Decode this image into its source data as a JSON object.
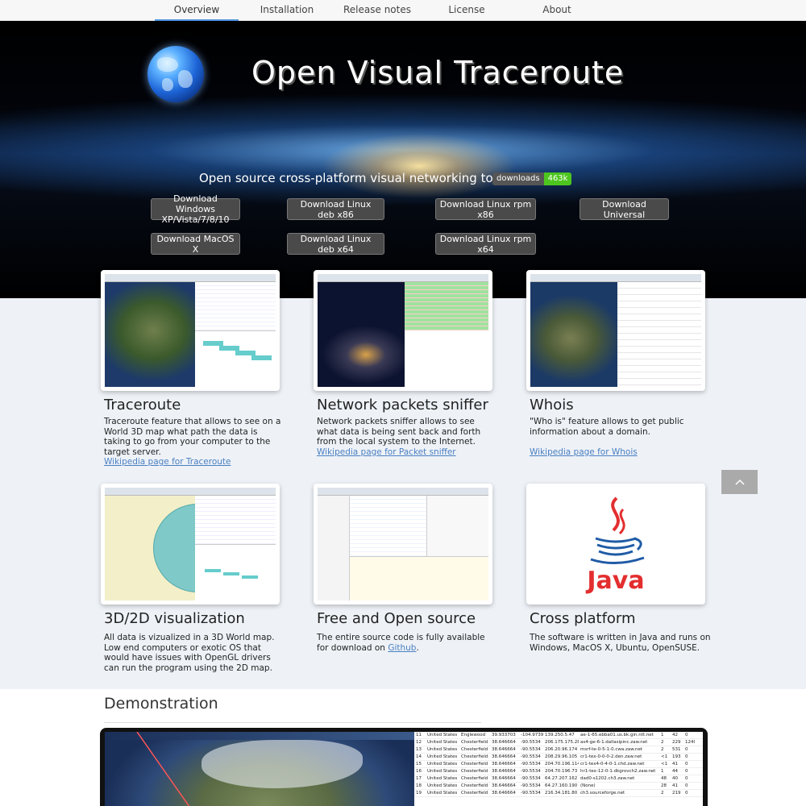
{
  "nav": {
    "items": [
      "Overview",
      "Installation",
      "Release notes",
      "License",
      "About"
    ],
    "active": "Overview"
  },
  "hero": {
    "title": "Open Visual Traceroute",
    "subtitle": "Open source cross-platform visual networking tool",
    "badge": {
      "label": "downloads",
      "value": "463k"
    },
    "downloads": [
      "Download Windows XP/Vista/7/8/10",
      "Download Linux deb x86",
      "Download Linux rpm x86",
      "Download Universal",
      "Download MacOS X",
      "Download Linux deb x64",
      "Download Linux rpm x64"
    ]
  },
  "features": [
    {
      "title": "Traceroute",
      "text": "Traceroute feature that allows to see on a World 3D map what path the data is taking to go from your computer to the target server.",
      "link": "Wikipedia page for Traceroute"
    },
    {
      "title": "Network packets sniffer",
      "text": "Network packets sniffer allows to see what data is being sent back and forth from the local system to the Internet.",
      "link": "Wikipedia page for Packet sniffer"
    },
    {
      "title": "Whois",
      "text": "\"Who is\" feature allows to get public information about a domain.",
      "link": "Wikipedia page for Whois"
    },
    {
      "title": "3D/2D visualization",
      "text": "All data is vizualized in a 3D World map. Low end computers or exotic OS that would have issues with OpenGL drivers can run the program using the 2D map.",
      "link": ""
    },
    {
      "title": "Free and Open source",
      "text": "The entire source code is fully available for download on ",
      "link": "Github",
      "suffix": "."
    },
    {
      "title": "Cross platform",
      "text": "The software is written in Java and runs on Windows, MacOS X, Ubuntu, OpenSUSE.",
      "link": ""
    }
  ],
  "java_logo_text": "Java",
  "back_to_top_icon": "chevron-up-icon",
  "demo": {
    "title": "Demonstration",
    "rows": [
      [
        "11",
        "United States",
        "Englewood",
        "39.933703",
        "-104.9739",
        "139.250.5.47",
        "ae-1-65.ebba01.us.bk.gin.ntt.net",
        "1",
        "42",
        "0"
      ],
      [
        "12",
        "United States",
        "Chesterfield",
        "38.646664",
        "-90.5534",
        "206.175.175.28",
        "as4-ge-6-1.dallasipinc.zaw.net",
        "2",
        "229",
        "1240"
      ],
      [
        "13",
        "United States",
        "Chesterfield",
        "38.646664",
        "-90.5534",
        "206.20.96.174",
        "msrf-te-0-5-1-0.cwa.zaw.net",
        "2",
        "531",
        "0"
      ],
      [
        "14",
        "United States",
        "Chesterfield",
        "38.646664",
        "-90.5534",
        "208.29.96.105",
        "cr1-tex-0-0-0-2.den.zaw.net",
        "<1",
        "193",
        "0"
      ],
      [
        "15",
        "United States",
        "Chesterfield",
        "38.646664",
        "-90.5534",
        "204.70.196.114",
        "cr1-tex4-0-4-0-1.chd.zaw.net",
        "<1",
        "41",
        "0"
      ],
      [
        "16",
        "United States",
        "Chesterfield",
        "38.646664",
        "-90.5534",
        "204.70.196.73",
        "hr1-tex-12-0-1.dkgrovch2.zaw.net",
        "1",
        "44",
        "0"
      ],
      [
        "17",
        "United States",
        "Chesterfield",
        "38.646664",
        "-90.5534",
        "64.27.207.162",
        "dad0-s1202.ch3.zaw.net",
        "48",
        "40",
        "0"
      ],
      [
        "18",
        "United States",
        "Chesterfield",
        "38.646664",
        "-90.5534",
        "64.27.160.190",
        "(None)",
        "28",
        "41",
        "0"
      ],
      [
        "19",
        "United States",
        "Chesterfield",
        "38.646664",
        "-90.5534",
        "216.34.181.80",
        "ch3.sourceforge.net",
        "2",
        "219",
        "0"
      ]
    ]
  },
  "colors": {
    "link": "#4a7fc1",
    "badge_green": "#4cc61e",
    "button_bg": "#4a4a4a",
    "java_red": "#e32e2f",
    "java_blue": "#1f5ba6"
  }
}
